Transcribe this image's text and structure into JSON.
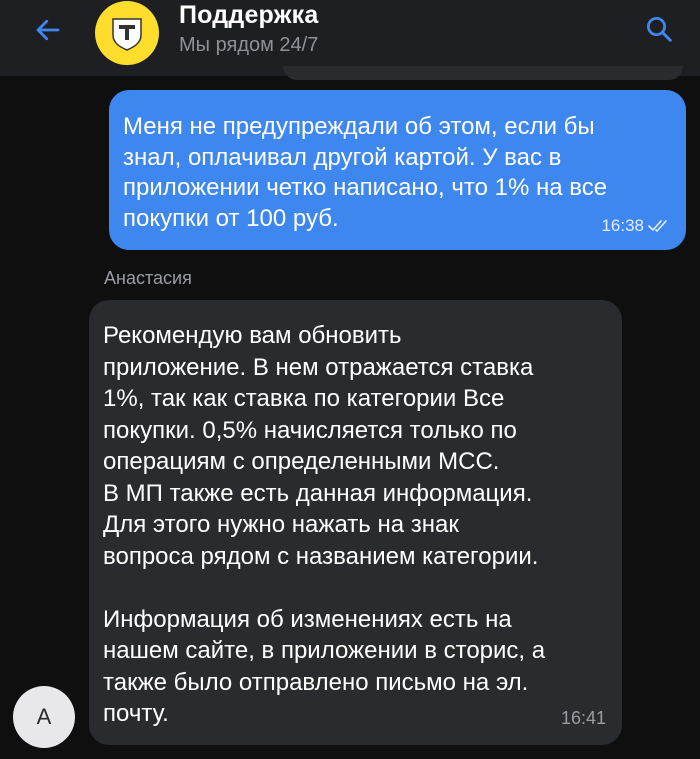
{
  "header": {
    "title": "Поддержка",
    "subtitle": "Мы рядом 24/7",
    "back_icon": "arrow-left-icon",
    "search_icon": "search-icon",
    "logo": "tinkoff-logo",
    "accent_color": "#3e87ee",
    "logo_color": "#ffdd2d"
  },
  "messages": [
    {
      "direction": "outgoing",
      "text": "Меня не предупреждали об этом, если бы\nзнал, оплачивал другой картой. У вас в\nприложении четко написано, что 1% на все\nпокупки от 100 руб.",
      "time": "16:38",
      "status_icon": "double-check-icon"
    },
    {
      "direction": "incoming",
      "sender": "Анастасия",
      "avatar_letter": "А",
      "text": "Рекомендую вам обновить\nприложение. В нем отражается ставка\n1%, так как ставка по категории Все\nпокупки. 0,5% начисляется только по\nоперациям с определенными МСС.\nВ МП также есть данная информация.\nДля этого нужно нажать на знак\nвопроса рядом с названием категории.\n\nИнформация об изменениях есть на\nнашем сайте, в приложении в сторис, а\nтакже было отправлено письмо на эл.\nпочту.",
      "time": "16:41"
    }
  ]
}
